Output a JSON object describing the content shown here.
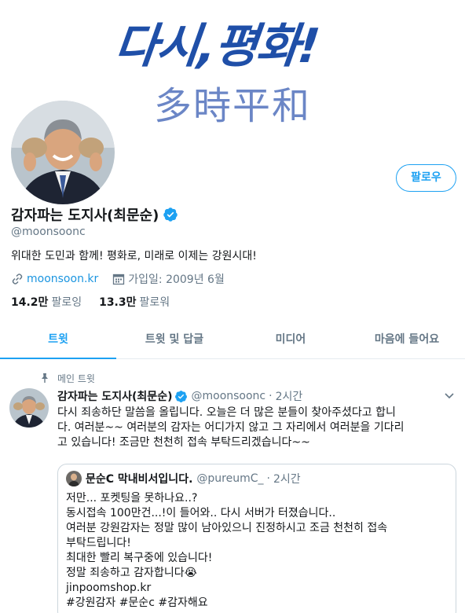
{
  "banner": {
    "title": "다시,평화!",
    "subtitle": "多時平和"
  },
  "profile": {
    "display_name": "감자파는 도지사(최문순)",
    "handle": "@moonsoonc",
    "bio": "위대한 도민과 함께! 평화로, 미래로 이제는 강원시대!",
    "link": "moonsoon.kr",
    "joined": "가입일: 2009년 6월",
    "following_count": "14.2만",
    "following_label": "팔로잉",
    "followers_count": "13.3만",
    "followers_label": "팔로워",
    "follow_button": "팔로우"
  },
  "tabs": [
    {
      "label": "트윗",
      "active": true
    },
    {
      "label": "트윗 및 답글",
      "active": false
    },
    {
      "label": "미디어",
      "active": false
    },
    {
      "label": "마음에 들어요",
      "active": false
    }
  ],
  "pinned": {
    "label": "메인 트윗"
  },
  "tweet": {
    "display_name": "감자파는 도지사(최문순)",
    "handle": "@moonsoonc",
    "separator": "·",
    "time": "2시간",
    "lines": [
      "다시 죄송하단 말씀을 올립니다. 오늘은 더 많은 분들이 찾아주셨다고 합니",
      "다. 여러분~~ 여러분의 감자는 어디가지 않고 그 자리에서 여러분을 기다리",
      "고 있습니다! 조금만 천천히 접속 부탁드리겠습니다~~"
    ]
  },
  "quote": {
    "display_name": "문순C 막내비서입니다.",
    "handle": "@pureumC_",
    "separator": "·",
    "time": "2시간",
    "lines": [
      "저만... 포켓팅을 못하나요..?",
      "동시접속 100만건...!이 들어와.. 다시 서버가 터졌습니다..",
      "여러분 강원감자는 정말 많이 남아있으니 진정하시고 조금 천천히 접속",
      "부탁드립니다!",
      "최대한 빨리 복구중에 있습니다!",
      "정말 죄송하고 감자합니다😭",
      "jinpoomshop.kr",
      "#강원감자 #문순c #감자해요"
    ]
  },
  "colors": {
    "accent": "#1da1f2",
    "banner_blue": "#1f4fa8",
    "muted": "#657786"
  }
}
